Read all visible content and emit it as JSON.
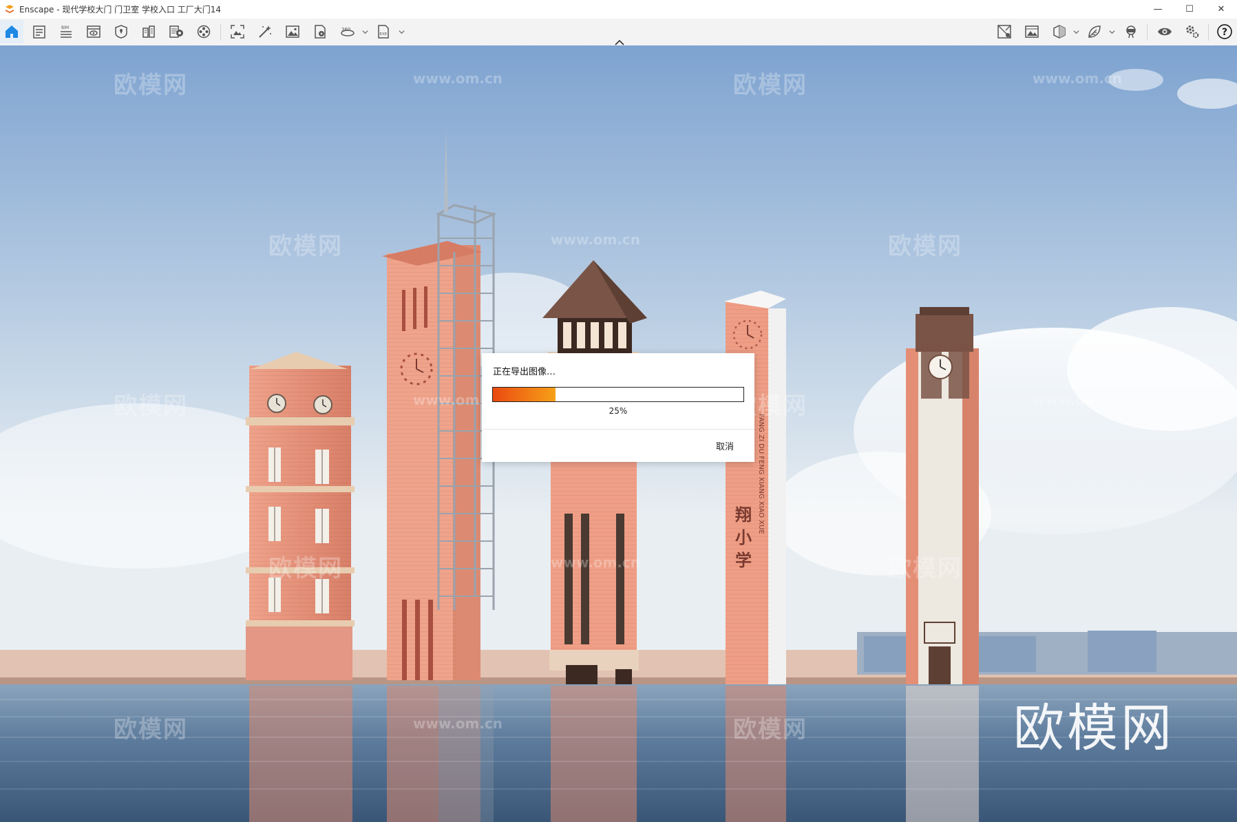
{
  "window": {
    "app_icon": "enscape-logo",
    "title": "Enscape - 现代学校大门 门卫室 学校入口 工厂大门14",
    "controls": {
      "minimize": "—",
      "maximize": "☐",
      "close": "✕"
    }
  },
  "toolbar": {
    "left_icons": [
      "home-icon",
      "bim-notes-icon",
      "bim-info-icon",
      "view-management-icon",
      "site-context-icon",
      "asset-library-icon",
      "material-editor-icon",
      "video-editor-icon",
      "screenshot-icon",
      "batch-render-icon",
      "image-export-icon",
      "pdf-export-icon",
      "panorama-360-icon",
      "exe-export-icon"
    ],
    "right_icons": [
      "map-icon",
      "visual-settings-icon",
      "cube-view-icon",
      "leaf-icon",
      "vr-headset-icon",
      "eye-icon",
      "settings-icon",
      "help-icon"
    ],
    "help_label": "?"
  },
  "dialog": {
    "title": "正在导出图像…",
    "progress": 25,
    "progress_text": "25%",
    "cancel_label": "取消"
  },
  "tower_sign": {
    "pinyin": "FANG ZI DU FENG XIANG XIAO XUE",
    "chars": [
      "翔",
      "小",
      "学"
    ]
  },
  "watermarks": {
    "cn": "欧模网",
    "en": "www.om.cn",
    "brand": "欧模网"
  },
  "colors": {
    "accent": "#1e88e5",
    "progress_start": "#ea4a10",
    "progress_end": "#f7a018",
    "brick": "#e98f78",
    "sky_top": "#7fa6d4",
    "water": "#4b6b8e"
  }
}
